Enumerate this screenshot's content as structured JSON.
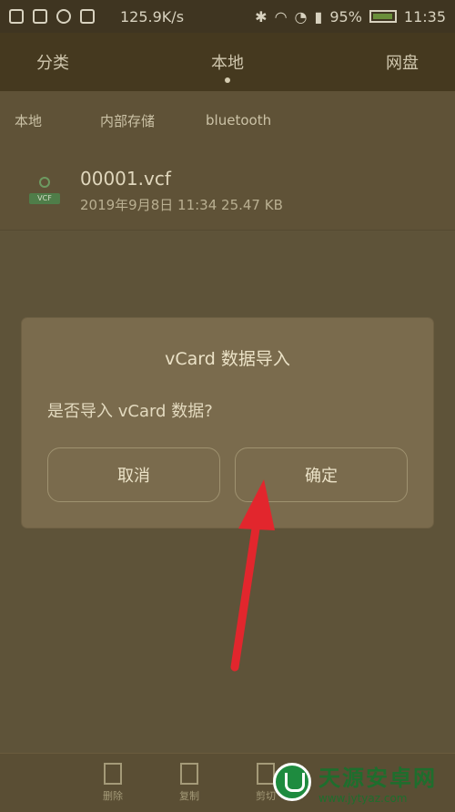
{
  "status_bar": {
    "speed": "125.9K/s",
    "battery": "95%",
    "time": "11:35"
  },
  "tabs": [
    {
      "label": "分类",
      "active": false
    },
    {
      "label": "本地",
      "active": true
    },
    {
      "label": "网盘",
      "active": false
    }
  ],
  "breadcrumb": [
    "本地",
    "内部存储",
    "bluetooth"
  ],
  "file": {
    "name": "00001.vcf",
    "meta": "2019年9月8日 11:34 25.47 KB",
    "icon_tag": "VCF"
  },
  "dialog": {
    "title": "vCard 数据导入",
    "message": "是否导入 vCard 数据?",
    "cancel": "取消",
    "confirm": "确定"
  },
  "bottom_bar": [
    "删除",
    "复制",
    "剪切"
  ],
  "watermark": {
    "name": "天源安卓网",
    "url": "www.jytyaz.com"
  },
  "colors": {
    "arrow": "#e2262d",
    "watermark_green": "#1e8b3f"
  }
}
